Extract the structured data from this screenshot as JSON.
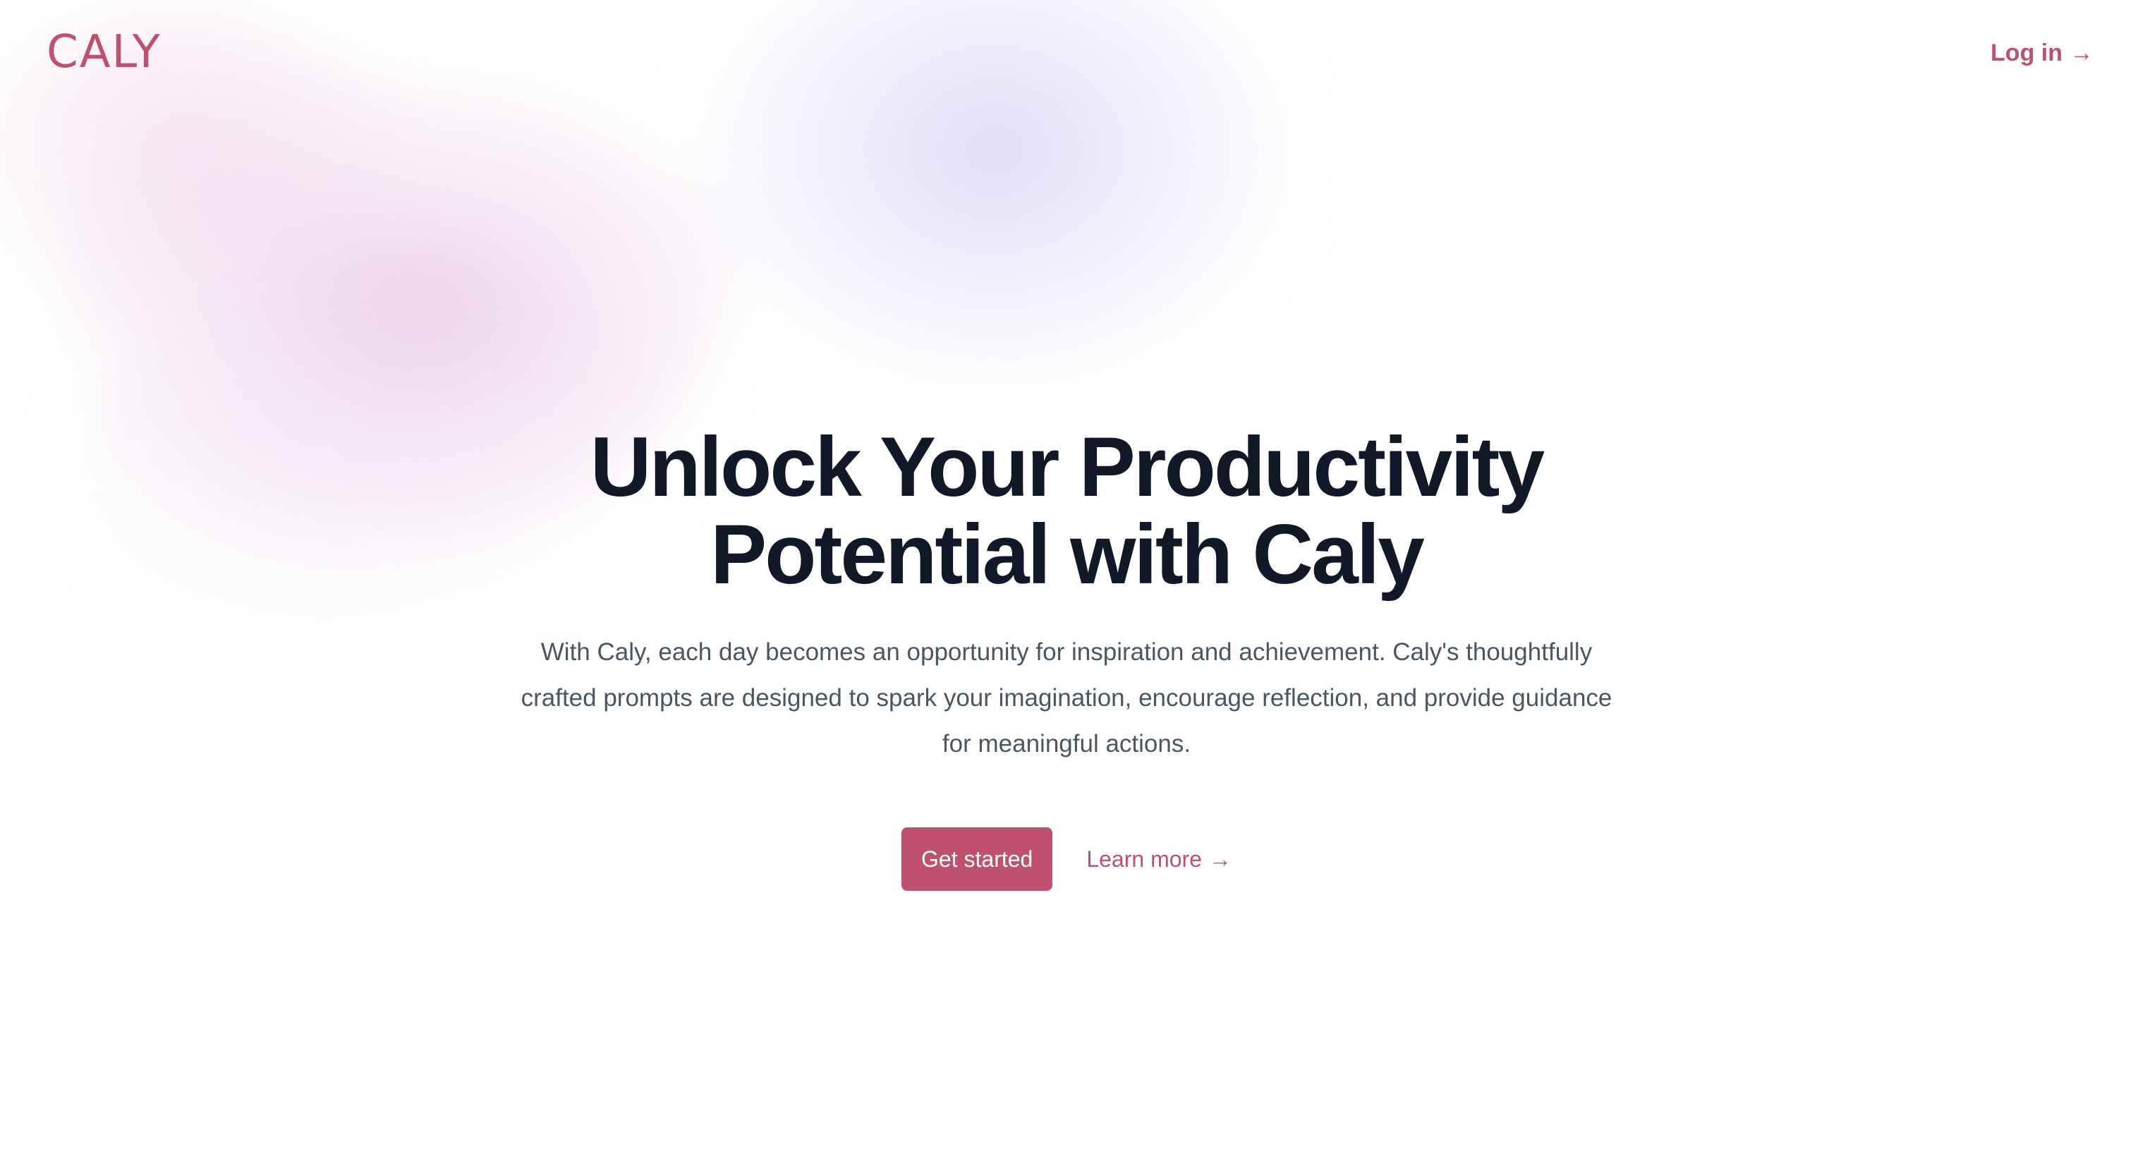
{
  "brand": {
    "logo_text": "CALY",
    "accent_color": "#c0506f"
  },
  "header": {
    "login_label": "Log in",
    "login_arrow": "→"
  },
  "hero": {
    "title_line1": "Unlock Your Productivity",
    "title_line2": "Potential with Caly",
    "description": "With Caly, each day becomes an opportunity for inspiration and achievement. Caly's thoughtfully crafted prompts are designed to spark your imagination, encourage reflection, and provide guidance for meaningful actions.",
    "primary_button": "Get started",
    "secondary_link": "Learn more",
    "secondary_arrow": "→"
  },
  "colors": {
    "heading": "#111827",
    "body_text": "#4b5563",
    "background": "#ffffff"
  }
}
